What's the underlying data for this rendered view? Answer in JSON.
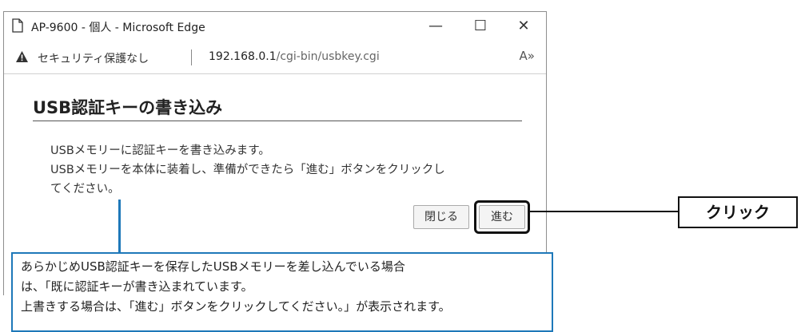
{
  "window": {
    "title": "AP-9600 - 個人 - Microsoft Edge",
    "controls": {
      "minimize": "—",
      "maximize": "☐",
      "close": "✕"
    }
  },
  "addressbar": {
    "security_text": "セキュリティ保護なし",
    "url_host": "192.168.0.1",
    "url_path": "/cgi-bin/usbkey.cgi",
    "read_aloud": "A»"
  },
  "page": {
    "title": "USB認証キーの書き込み",
    "message_lines": [
      "USBメモリーに認証キーを書き込みます。",
      "USBメモリーを本体に装着し、準備ができたら「進む」ボタンをクリックし",
      "てください。"
    ],
    "close_button": "閉じる",
    "next_button": "進む"
  },
  "annotation": {
    "click_label": "クリック",
    "note_lines": [
      "あらかじめUSB認証キーを保存したUSBメモリーを差し込んでいる場合",
      "は、「既に認証キーが書き込まれています。",
      "上書きする場合は、「進む」ボタンをクリックしてください。」が表示されます。"
    ],
    "accent_color": "#1e78b9"
  }
}
